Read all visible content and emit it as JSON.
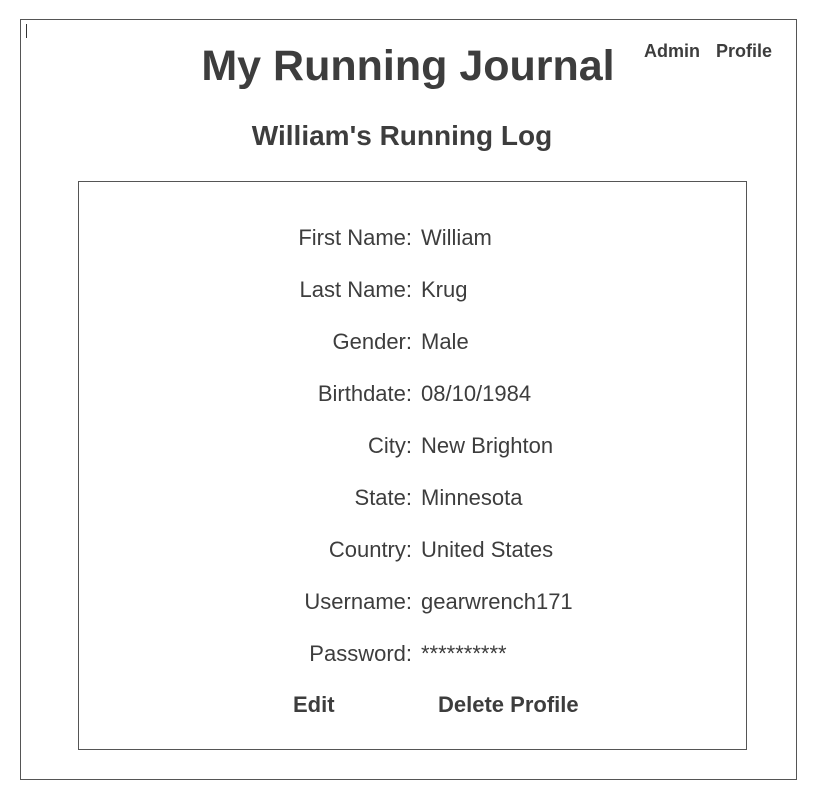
{
  "header": {
    "title": "My Running Journal",
    "nav": {
      "admin_label": "Admin",
      "profile_label": "Profile"
    }
  },
  "page": {
    "heading": "William's Running Log"
  },
  "profile": {
    "fields": [
      {
        "label": "First Name:",
        "value": "William"
      },
      {
        "label": "Last Name:",
        "value": "Krug"
      },
      {
        "label": "Gender:",
        "value": "Male"
      },
      {
        "label": "Birthdate:",
        "value": "08/10/1984"
      },
      {
        "label": "City:",
        "value": "New Brighton"
      },
      {
        "label": "State:",
        "value": "Minnesota"
      },
      {
        "label": "Country:",
        "value": "United States"
      },
      {
        "label": "Username:",
        "value": "gearwrench171"
      },
      {
        "label": "Password:",
        "value": "**********"
      }
    ],
    "actions": {
      "edit_label": "Edit",
      "delete_label": "Delete Profile"
    }
  },
  "colors": {
    "text": "#3d3d3d",
    "border": "#555555",
    "background": "#ffffff"
  }
}
